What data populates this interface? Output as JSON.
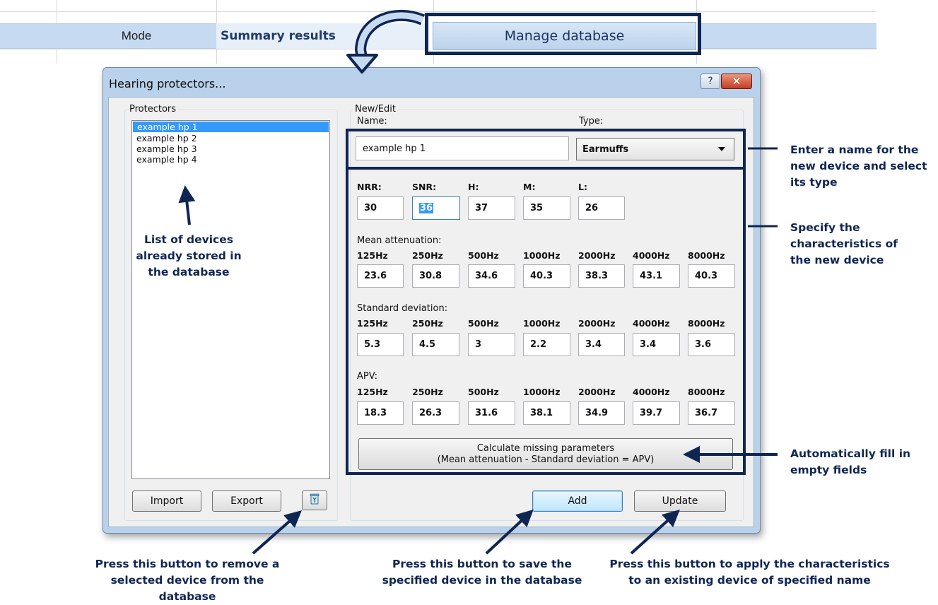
{
  "top_bar": {
    "mode_label": "Mode",
    "summary_label": "Summary results",
    "manage_label": "Manage database"
  },
  "dialog": {
    "title": "Hearing protectors...",
    "help_glyph": "?",
    "close_glyph": "✕",
    "protectors_group_label": "Protectors",
    "protectors": [
      "example hp 1",
      "example hp 2",
      "example hp 3",
      "example hp 4"
    ],
    "import_label": "Import",
    "export_label": "Export",
    "new_edit_group_label": "New/Edit",
    "name_label": "Name:",
    "name_value": "example hp 1",
    "type_label": "Type:",
    "type_value": "Earmuffs",
    "ratings": {
      "labels": [
        "NRR:",
        "SNR:",
        "H:",
        "M:",
        "L:"
      ],
      "values": [
        "30",
        "36",
        "37",
        "35",
        "26"
      ]
    },
    "freq_labels": [
      "125Hz",
      "250Hz",
      "500Hz",
      "1000Hz",
      "2000Hz",
      "4000Hz",
      "8000Hz"
    ],
    "mean_attenuation": {
      "label": "Mean attenuation:",
      "values": [
        "23.6",
        "30.8",
        "34.6",
        "40.3",
        "38.3",
        "43.1",
        "40.3"
      ]
    },
    "standard_deviation": {
      "label": "Standard deviation:",
      "values": [
        "5.3",
        "4.5",
        "3",
        "2.2",
        "3.4",
        "3.4",
        "3.6"
      ]
    },
    "apv": {
      "label": "APV:",
      "values": [
        "18.3",
        "26.3",
        "31.6",
        "38.1",
        "34.9",
        "39.7",
        "36.7"
      ]
    },
    "calc_button_line1": "Calculate missing parameters",
    "calc_button_line2": "(Mean attenuation - Standard deviation = APV)",
    "add_label": "Add",
    "update_label": "Update"
  },
  "annotations": {
    "list_note": "List of devices already stored in the database",
    "name_note": "Enter a name for the new device and select its type",
    "spec_note": "Specify the characteristics of the new device",
    "auto_note": "Automatically fill in empty fields",
    "remove_note": "Press this button to remove a selected device from the database",
    "save_note": "Press this button to save the specified device in the database",
    "apply_note": "Press this button to apply the characteristics to an existing device of specified name"
  },
  "colors": {
    "annotation_navy": "#0f2653",
    "selection_blue": "#3399ff",
    "window_frame": "#b9d1ea"
  }
}
